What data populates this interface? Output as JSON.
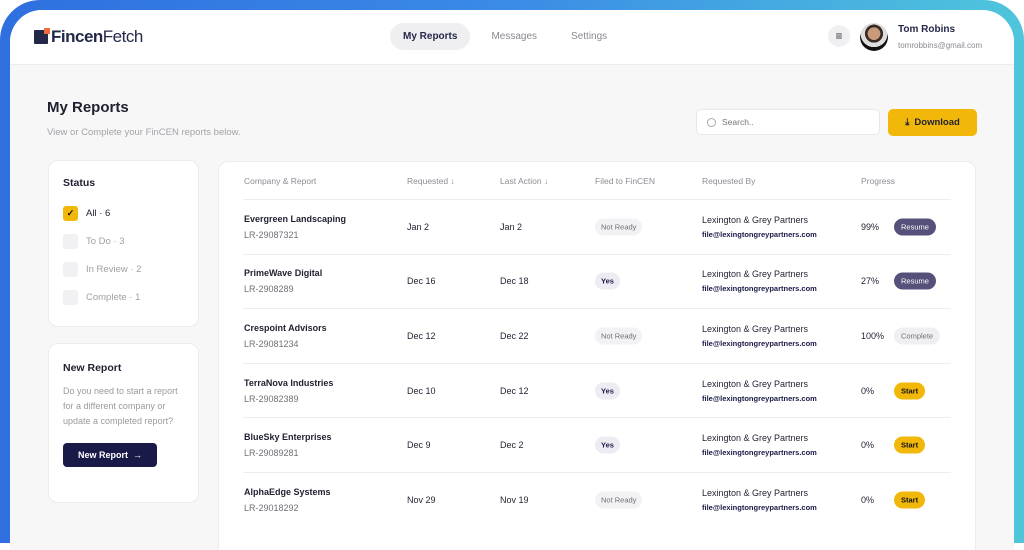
{
  "app": {
    "logo_bold": "Fincen",
    "logo_light": "Fetch"
  },
  "nav": [
    {
      "label": "My Reports",
      "active": true
    },
    {
      "label": "Messages"
    },
    {
      "label": "Settings"
    }
  ],
  "user": {
    "name": "Tom Robins",
    "email": "tomrobbins@gmail.com"
  },
  "page": {
    "title": "My Reports",
    "subtitle": "View or Complete your FinCEN reports below."
  },
  "search": {
    "placeholder": "Search..",
    "value": ""
  },
  "download_label": "Download",
  "status": {
    "title": "Status",
    "filters": [
      {
        "label": "All · 6",
        "checked": true
      },
      {
        "label": "To Do · 3"
      },
      {
        "label": "In Review · 2"
      },
      {
        "label": "Complete · 1"
      }
    ]
  },
  "new_report": {
    "title": "New Report",
    "text": "Do you need to start a report for a different company or update a completed report?",
    "button": "New Report"
  },
  "table": {
    "columns": [
      "Company & Report",
      "Requested ↓",
      "Last Action ↓",
      "Filed to FinCEN",
      "Requested By",
      "Progress"
    ],
    "rows": [
      {
        "company": "Evergreen Landscaping",
        "id": "LR-29087321",
        "requested": "Jan 2",
        "last_action": "Jan 2",
        "filed": "Not Ready",
        "req_by": "Lexington & Grey Partners",
        "email": "file@lexingtongreypartners.com",
        "progress": "99%",
        "action": "Resume"
      },
      {
        "company": "PrimeWave Digital",
        "id": "LR-2908289",
        "requested": "Dec 16",
        "last_action": "Dec 18",
        "filed": "Yes",
        "req_by": "Lexington & Grey Partners",
        "email": "file@lexingtongreypartners.com",
        "progress": "27%",
        "action": "Resume"
      },
      {
        "company": "Crespoint Advisors",
        "id": "LR-29081234",
        "requested": "Dec 12",
        "last_action": "Dec 22",
        "filed": "Not Ready",
        "req_by": "Lexington & Grey Partners",
        "email": "file@lexingtongreypartners.com",
        "progress": "100%",
        "action": "Complete"
      },
      {
        "company": "TerraNova Industries",
        "id": "LR-29082389",
        "requested": "Dec 10",
        "last_action": "Dec 12",
        "filed": "Yes",
        "req_by": "Lexington & Grey Partners",
        "email": "file@lexingtongreypartners.com",
        "progress": "0%",
        "action": "Start"
      },
      {
        "company": "BlueSky Enterprises",
        "id": "LR-29089281",
        "requested": "Dec 9",
        "last_action": "Dec 2",
        "filed": "Yes",
        "req_by": "Lexington & Grey Partners",
        "email": "file@lexingtongreypartners.com",
        "progress": "0%",
        "action": "Start"
      },
      {
        "company": "AlphaEdge Systems",
        "id": "LR-29018292",
        "requested": "Nov 29",
        "last_action": "Nov 19",
        "filed": "Not Ready",
        "req_by": "Lexington & Grey Partners",
        "email": "file@lexingtongreypartners.com",
        "progress": "0%",
        "action": "Start"
      }
    ]
  }
}
